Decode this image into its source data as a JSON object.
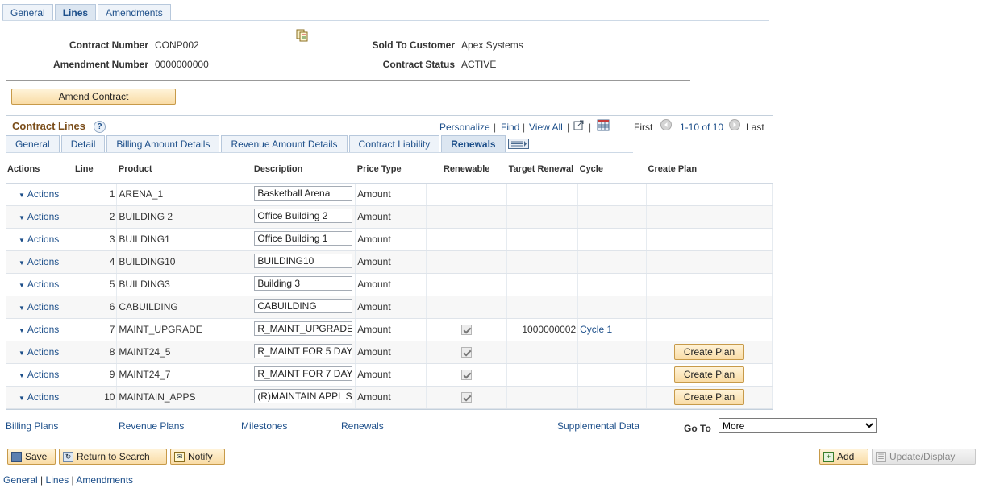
{
  "top_tabs": [
    {
      "label": "General",
      "active": false
    },
    {
      "label": "Lines",
      "active": true
    },
    {
      "label": "Amendments",
      "active": false
    }
  ],
  "header": {
    "contract_number_label": "Contract Number",
    "contract_number": "CONP002",
    "amendment_number_label": "Amendment Number",
    "amendment_number": "0000000000",
    "sold_to_label": "Sold To Customer",
    "sold_to": "Apex Systems",
    "status_label": "Contract Status",
    "status": "ACTIVE"
  },
  "amend_button": "Amend Contract",
  "grid": {
    "title": "Contract Lines",
    "help": "?",
    "nav": {
      "personalize": "Personalize",
      "find": "Find",
      "view_all": "View All",
      "first": "First",
      "range": "1-10 of 10",
      "last": "Last"
    },
    "sub_tabs": [
      {
        "label": "General",
        "active": false
      },
      {
        "label": "Detail",
        "active": false
      },
      {
        "label": "Billing Amount Details",
        "active": false
      },
      {
        "label": "Revenue Amount Details",
        "active": false
      },
      {
        "label": "Contract Liability",
        "active": false
      },
      {
        "label": "Renewals",
        "active": true
      }
    ],
    "columns": {
      "actions": "Actions",
      "line": "Line",
      "product": "Product",
      "description": "Description",
      "price_type": "Price Type",
      "renewable": "Renewable",
      "target_renewal": "Target Renewal",
      "cycle": "Cycle",
      "create_plan": "Create Plan"
    },
    "rows": [
      {
        "action": "Actions",
        "line": "1",
        "product": "ARENA_1",
        "description": "Basketball Arena",
        "price_type": "Amount",
        "renewable": false,
        "target": "",
        "cycle": "",
        "plan": ""
      },
      {
        "action": "Actions",
        "line": "2",
        "product": "BUILDING 2",
        "description": "Office Building 2",
        "price_type": "Amount",
        "renewable": false,
        "target": "",
        "cycle": "",
        "plan": ""
      },
      {
        "action": "Actions",
        "line": "3",
        "product": "BUILDING1",
        "description": "Office Building 1",
        "price_type": "Amount",
        "renewable": false,
        "target": "",
        "cycle": "",
        "plan": ""
      },
      {
        "action": "Actions",
        "line": "4",
        "product": "BUILDING10",
        "description": "BUILDING10",
        "price_type": "Amount",
        "renewable": false,
        "target": "",
        "cycle": "",
        "plan": ""
      },
      {
        "action": "Actions",
        "line": "5",
        "product": "BUILDING3",
        "description": "Building 3",
        "price_type": "Amount",
        "renewable": false,
        "target": "",
        "cycle": "",
        "plan": ""
      },
      {
        "action": "Actions",
        "line": "6",
        "product": "CABUILDING",
        "description": "CABUILDING",
        "price_type": "Amount",
        "renewable": false,
        "target": "",
        "cycle": "",
        "plan": ""
      },
      {
        "action": "Actions",
        "line": "7",
        "product": "MAINT_UPGRADE",
        "description": "R_MAINT_UPGRADE",
        "price_type": "Amount",
        "renewable": true,
        "target": "1000000002",
        "cycle": "Cycle 1",
        "plan": ""
      },
      {
        "action": "Actions",
        "line": "8",
        "product": "MAINT24_5",
        "description": "R_MAINT FOR 5 DAY",
        "price_type": "Amount",
        "renewable": true,
        "target": "",
        "cycle": "",
        "plan": "Create Plan"
      },
      {
        "action": "Actions",
        "line": "9",
        "product": "MAINT24_7",
        "description": "R_MAINT FOR 7 DAY",
        "price_type": "Amount",
        "renewable": true,
        "target": "",
        "cycle": "",
        "plan": "Create Plan"
      },
      {
        "action": "Actions",
        "line": "10",
        "product": "MAINTAIN_APPS",
        "description": "(R)MAINTAIN APPL S",
        "price_type": "Amount",
        "renewable": true,
        "target": "",
        "cycle": "",
        "plan": "Create Plan"
      }
    ]
  },
  "bottom_links": {
    "billing_plans": "Billing Plans",
    "revenue_plans": "Revenue Plans",
    "milestones": "Milestones",
    "renewals": "Renewals",
    "supplemental": "Supplemental Data",
    "goto_label": "Go To",
    "goto_value": "More"
  },
  "toolbar": {
    "save": "Save",
    "return": "Return to Search",
    "notify": "Notify",
    "add": "Add",
    "update": "Update/Display"
  },
  "footer": {
    "general": "General",
    "lines": "Lines",
    "amendments": "Amendments",
    "sep": "|"
  }
}
